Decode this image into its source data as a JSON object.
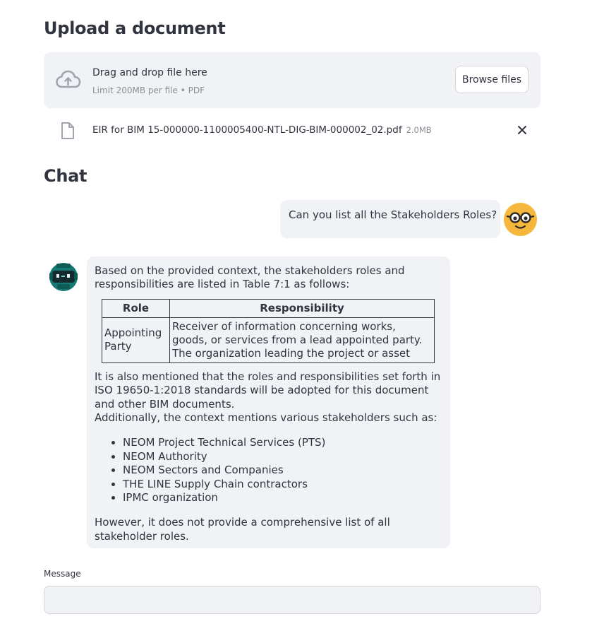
{
  "upload": {
    "title": "Upload a document",
    "drop_text": "Drag and drop file here",
    "limit_text": "Limit 200MB per file • PDF",
    "browse_label": "Browse files",
    "file": {
      "name": "EIR for BIM 15-000000-1100005400-NTL-DIG-BIM-000002_02.pdf",
      "size": "2.0MB"
    }
  },
  "chat": {
    "title": "Chat",
    "user_message": "Can you list all the Stakeholders Roles?",
    "bot": {
      "intro": "Based on the provided context, the stakeholders roles and responsibilities are listed in Table 7:1 as follows:",
      "table": {
        "headers": [
          "Role",
          "Responsibility"
        ],
        "rows": [
          [
            "Appointing Party",
            "Receiver of information concerning works, goods, or services from a lead appointed party. The organization leading the project or asset"
          ]
        ]
      },
      "para1": "It is also mentioned that the roles and responsibilities set forth in ISO 19650-1:2018 standards will be adopted for this document and other BIM documents.",
      "para2": "Additionally, the context mentions various stakeholders such as:",
      "list": [
        "NEOM Project Technical Services (PTS)",
        "NEOM Authority",
        "NEOM Sectors and Companies",
        "THE LINE Supply Chain contractors",
        "IPMC organization"
      ],
      "outro": "However, it does not provide a comprehensive list of all stakeholder roles."
    }
  },
  "input": {
    "label": "Message",
    "value": "",
    "placeholder": ""
  },
  "icons": {
    "upload": "cloud-upload-icon",
    "file": "file-icon",
    "close": "close-icon",
    "user_avatar": "nerd-face-avatar",
    "bot_avatar": "robot-avatar"
  },
  "colors": {
    "panel_bg": "#f0f2f6",
    "text": "#31333f",
    "muted": "#8b8d96",
    "user_avatar": "#f5b83d",
    "bot_avatar": "#167a74"
  }
}
